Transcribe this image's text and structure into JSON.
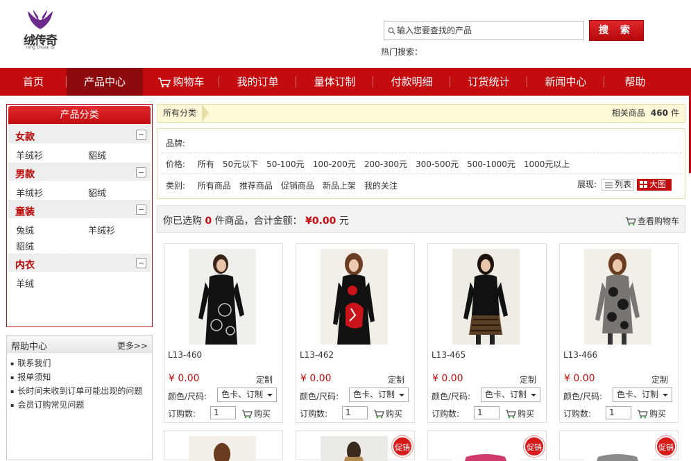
{
  "brand": {
    "name": "绒传奇",
    "sub": "rong chuan qi",
    "color": "#6b2a8c"
  },
  "search": {
    "placeholder": "输入您要查找的产品",
    "button": "搜 索",
    "hot_label": "热门搜索："
  },
  "nav": {
    "items": [
      {
        "label": "首页",
        "active": false,
        "icon": ""
      },
      {
        "label": "产品中心",
        "active": true,
        "icon": ""
      },
      {
        "label": "购物车",
        "active": false,
        "icon": "cart-icon"
      },
      {
        "label": "我的订单",
        "active": false,
        "icon": ""
      },
      {
        "label": "量体订制",
        "active": false,
        "icon": ""
      },
      {
        "label": "付款明细",
        "active": false,
        "icon": ""
      },
      {
        "label": "订货统计",
        "active": false,
        "icon": ""
      },
      {
        "label": "新闻中心",
        "active": false,
        "icon": ""
      },
      {
        "label": "帮助",
        "active": false,
        "icon": ""
      }
    ]
  },
  "categories": {
    "title": "产品分类",
    "groups": [
      {
        "name": "女款",
        "items": [
          "羊绒衫",
          "貂绒"
        ]
      },
      {
        "name": "男款",
        "items": [
          "羊绒衫",
          "貂绒"
        ]
      },
      {
        "name": "童装",
        "items": [
          "兔绒",
          "羊绒衫",
          "貂绒"
        ]
      },
      {
        "name": "内衣",
        "items": [
          "羊绒"
        ]
      }
    ]
  },
  "help": {
    "title": "帮助中心",
    "more": "更多>>",
    "items": [
      "联系我们",
      "报单须知",
      "长时间未收到订单可能出现的问题",
      "会员订购常见问题"
    ]
  },
  "crumb": {
    "label": "所有分类",
    "count_prefix": "相关商品",
    "count": "460",
    "count_suffix": "件"
  },
  "filters": {
    "brand_label": "品牌:",
    "price_label": "价格:",
    "prices": [
      "所有",
      "50元以下",
      "50-100元",
      "100-200元",
      "200-300元",
      "300-500元",
      "500-1000元",
      "1000元以上"
    ],
    "type_label": "类别:",
    "types": [
      "所有商品",
      "推荐商品",
      "促销商品",
      "新品上架",
      "我的关注"
    ],
    "view_label": "展现:",
    "view_list": "列表",
    "view_big": "大图"
  },
  "summary": {
    "prefix": "你已选购",
    "count": "0",
    "middle": "件商品，合计金额：",
    "amount": "¥0.00",
    "suffix": "元",
    "cart": "查看购物车"
  },
  "products": [
    {
      "code": "L13-460",
      "price": "¥ 0.00",
      "custom": "定制",
      "color_label": "颜色/尺码:",
      "option": "色卡、订制",
      "qty_label": "订购数:",
      "qty": "1",
      "buy": "购买"
    },
    {
      "code": "L13-462",
      "price": "¥ 0.00",
      "custom": "定制",
      "color_label": "颜色/尺码:",
      "option": "色卡、订制",
      "qty_label": "订购数:",
      "qty": "1",
      "buy": "购买"
    },
    {
      "code": "L13-465",
      "price": "¥ 0.00",
      "custom": "定制",
      "color_label": "颜色/尺码:",
      "option": "色卡、订制",
      "qty_label": "订购数:",
      "qty": "1",
      "buy": "购买"
    },
    {
      "code": "L13-466",
      "price": "¥ 0.00",
      "custom": "定制",
      "color_label": "颜色/尺码:",
      "option": "色卡、订制",
      "qty_label": "订购数:",
      "qty": "1",
      "buy": "购买"
    }
  ],
  "promo_label": "促销",
  "colors": {
    "primary": "#c40c0f",
    "active_nav": "#8e0b0d",
    "price": "#c40c0f"
  }
}
